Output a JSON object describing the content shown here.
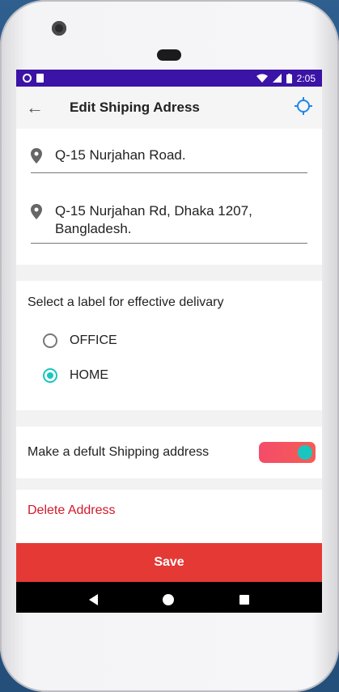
{
  "statusbar": {
    "time": "2:05"
  },
  "appbar": {
    "title": "Edit Shiping Adress"
  },
  "address": {
    "line1": "Q-15 Nurjahan Road.",
    "line2_a": "Q-15 Nurjahan Rd, Dhaka 1207,",
    "line2_b": "Bangladesh."
  },
  "labels": {
    "heading": "Select a label for effective delivary",
    "options": [
      {
        "label": "OFFICE",
        "selected": false
      },
      {
        "label": "HOME",
        "selected": true
      }
    ]
  },
  "default_address": {
    "label": "Make a defult Shipping address",
    "enabled": true
  },
  "delete": {
    "label": "Delete Address"
  },
  "save": {
    "label": "Save"
  },
  "colors": {
    "status_bar": "#3b13a6",
    "accent": "#19c6bf",
    "save": "#e53935",
    "delete_text": "#d3192b",
    "locate_icon": "#1e88e5"
  },
  "icons": [
    "back-arrow-icon",
    "crosshair-locate-icon",
    "location-pin-icon",
    "wifi-icon",
    "signal-icon",
    "battery-icon",
    "nav-back-icon",
    "nav-home-icon",
    "nav-recents-icon"
  ]
}
